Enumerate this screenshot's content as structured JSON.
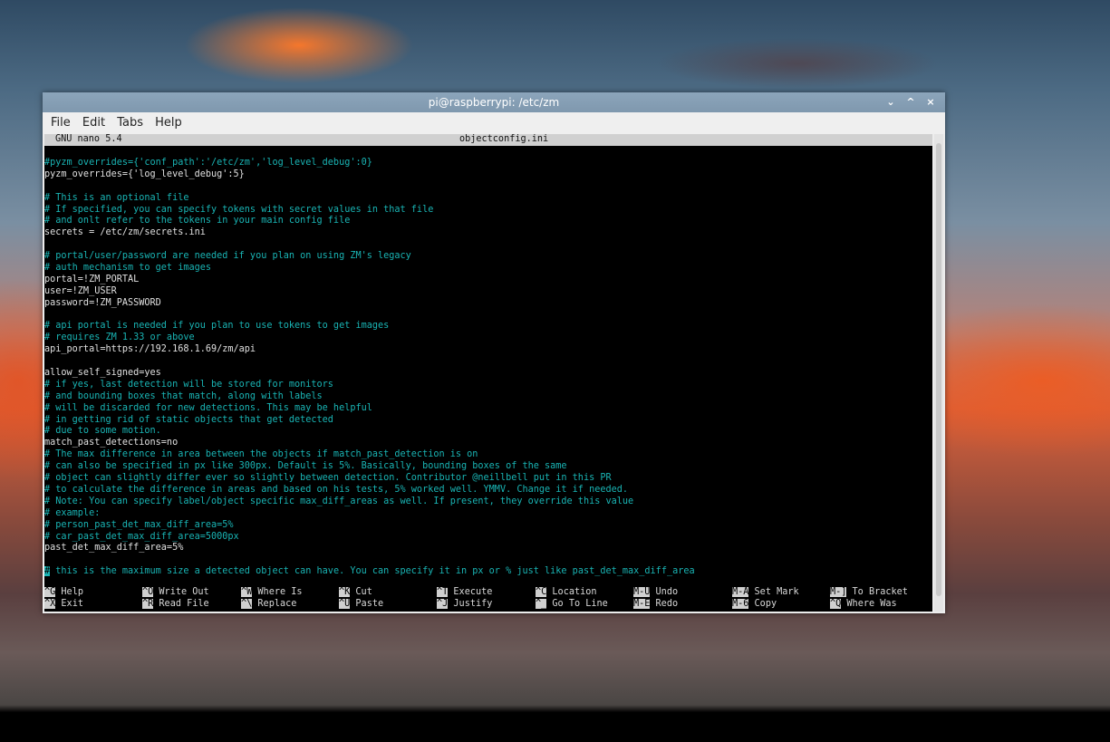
{
  "window": {
    "title": "pi@raspberrypi: /etc/zm",
    "controls": [
      "⌄",
      "^",
      "×"
    ]
  },
  "menu": [
    "File",
    "Edit",
    "Tabs",
    "Help"
  ],
  "nano": {
    "version": "GNU nano 5.4",
    "filename": "objectconfig.ini"
  },
  "lines": [
    {
      "type": "c",
      "text": "#pyzm_overrides={'conf_path':'/etc/zm','log_level_debug':0}"
    },
    {
      "type": "t",
      "text": "pyzm_overrides={'log_level_debug':5}"
    },
    {
      "type": "t",
      "text": ""
    },
    {
      "type": "c",
      "text": "# This is an optional file"
    },
    {
      "type": "c",
      "text": "# If specified, you can specify tokens with secret values in that file"
    },
    {
      "type": "c",
      "text": "# and onlt refer to the tokens in your main config file"
    },
    {
      "type": "t",
      "text": "secrets = /etc/zm/secrets.ini"
    },
    {
      "type": "t",
      "text": ""
    },
    {
      "type": "c",
      "text": "# portal/user/password are needed if you plan on using ZM's legacy"
    },
    {
      "type": "c",
      "text": "# auth mechanism to get images"
    },
    {
      "type": "t",
      "text": "portal=!ZM_PORTAL"
    },
    {
      "type": "t",
      "text": "user=!ZM_USER"
    },
    {
      "type": "t",
      "text": "password=!ZM_PASSWORD"
    },
    {
      "type": "t",
      "text": ""
    },
    {
      "type": "c",
      "text": "# api portal is needed if you plan to use tokens to get images"
    },
    {
      "type": "c",
      "text": "# requires ZM 1.33 or above"
    },
    {
      "type": "t",
      "text": "api_portal=https://192.168.1.69/zm/api"
    },
    {
      "type": "t",
      "text": ""
    },
    {
      "type": "t",
      "text": "allow_self_signed=yes"
    },
    {
      "type": "c",
      "text": "# if yes, last detection will be stored for monitors"
    },
    {
      "type": "c",
      "text": "# and bounding boxes that match, along with labels"
    },
    {
      "type": "c",
      "text": "# will be discarded for new detections. This may be helpful"
    },
    {
      "type": "c",
      "text": "# in getting rid of static objects that get detected"
    },
    {
      "type": "c",
      "text": "# due to some motion."
    },
    {
      "type": "t",
      "text": "match_past_detections=no"
    },
    {
      "type": "c",
      "text": "# The max difference in area between the objects if match_past_detection is on"
    },
    {
      "type": "c",
      "text": "# can also be specified in px like 300px. Default is 5%. Basically, bounding boxes of the same"
    },
    {
      "type": "c",
      "text": "# object can slightly differ ever so slightly between detection. Contributor @neillbell put in this PR"
    },
    {
      "type": "c",
      "text": "# to calculate the difference in areas and based on his tests, 5% worked well. YMMV. Change it if needed."
    },
    {
      "type": "c",
      "text": "# Note: You can specify label/object specific max_diff_areas as well. If present, they override this value"
    },
    {
      "type": "c",
      "text": "# example:"
    },
    {
      "type": "c",
      "text": "# person_past_det_max_diff_area=5%"
    },
    {
      "type": "c",
      "text": "# car_past_det_max_diff_area=5000px"
    },
    {
      "type": "t",
      "text": "past_det_max_diff_area=5%"
    },
    {
      "type": "t",
      "text": ""
    }
  ],
  "cursor_line": {
    "cursor_char": "#",
    "rest": " this is the maximum size a detected object can have. You can specify it in px or % just like past_det_max_diff_area"
  },
  "shortcuts": {
    "row1": [
      {
        "key": "^G",
        "label": "Help"
      },
      {
        "key": "^O",
        "label": "Write Out"
      },
      {
        "key": "^W",
        "label": "Where Is"
      },
      {
        "key": "^K",
        "label": "Cut"
      },
      {
        "key": "^T",
        "label": "Execute"
      },
      {
        "key": "^C",
        "label": "Location"
      },
      {
        "key": "M-U",
        "label": "Undo"
      },
      {
        "key": "M-A",
        "label": "Set Mark"
      },
      {
        "key": "M-]",
        "label": "To Bracket"
      }
    ],
    "row2": [
      {
        "key": "^X",
        "label": "Exit"
      },
      {
        "key": "^R",
        "label": "Read File"
      },
      {
        "key": "^\\",
        "label": "Replace"
      },
      {
        "key": "^U",
        "label": "Paste"
      },
      {
        "key": "^J",
        "label": "Justify"
      },
      {
        "key": "^_",
        "label": "Go To Line"
      },
      {
        "key": "M-E",
        "label": "Redo"
      },
      {
        "key": "M-6",
        "label": "Copy"
      },
      {
        "key": "^Q",
        "label": "Where Was"
      }
    ]
  }
}
